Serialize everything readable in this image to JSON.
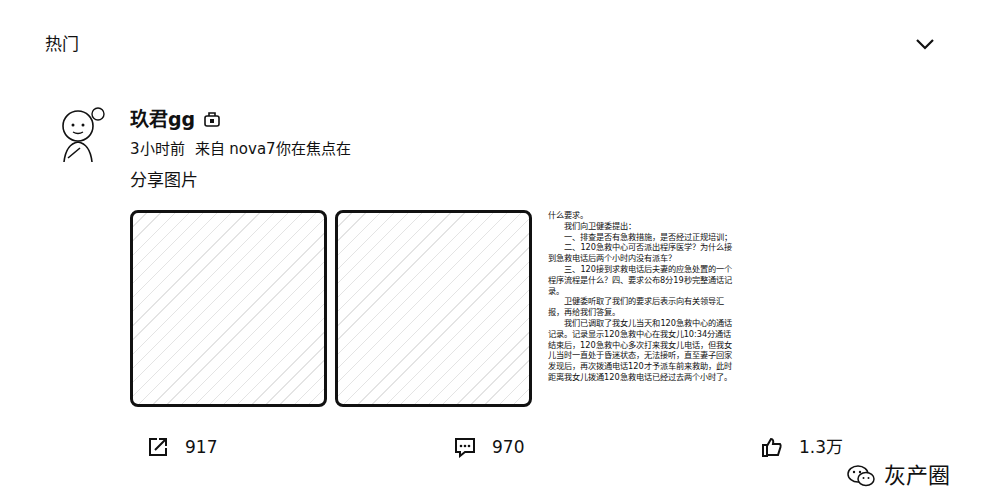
{
  "header": {
    "title": "热门"
  },
  "post": {
    "author": "玖君gg",
    "time": "3小时前",
    "source": "来自 nova7你在焦点在",
    "text": "分享图片",
    "images": [
      {
        "kind": "photo"
      },
      {
        "kind": "photo"
      },
      {
        "kind": "document",
        "lines": [
          "什么要求。",
          "我们向卫健委提出：",
          "一、排查是否有急救措施，是否经过正规培训；",
          "二、120急救中心可否派出程序医学？为什么接到急救电话后两个小时内没有派车？",
          "三、120接到求救电话后夫妻的应急处置的一个程序流程是什么？四、要求公布8分19秒完整通话记录。",
          "卫健委听取了我们的要求后表示向有关领导汇报，再给我们答复。",
          "我们已调取了我女儿当天和120急救中心的通话记录。记录显示120急救中心在我女儿10:34分通话结束后，120急救中心多次打来我女儿电话，但我女儿当时一直处于昏迷状态，无法接听，直至妻子回家发现后，再次拨通电话120才予派车前来救助，此时距离我女儿拨通120急救电话已经过去两个小时了。"
        ]
      }
    ]
  },
  "actions": [
    {
      "label": "917"
    },
    {
      "label": "970"
    },
    {
      "label": "1.3万"
    }
  ],
  "watermark": "灰产圈"
}
